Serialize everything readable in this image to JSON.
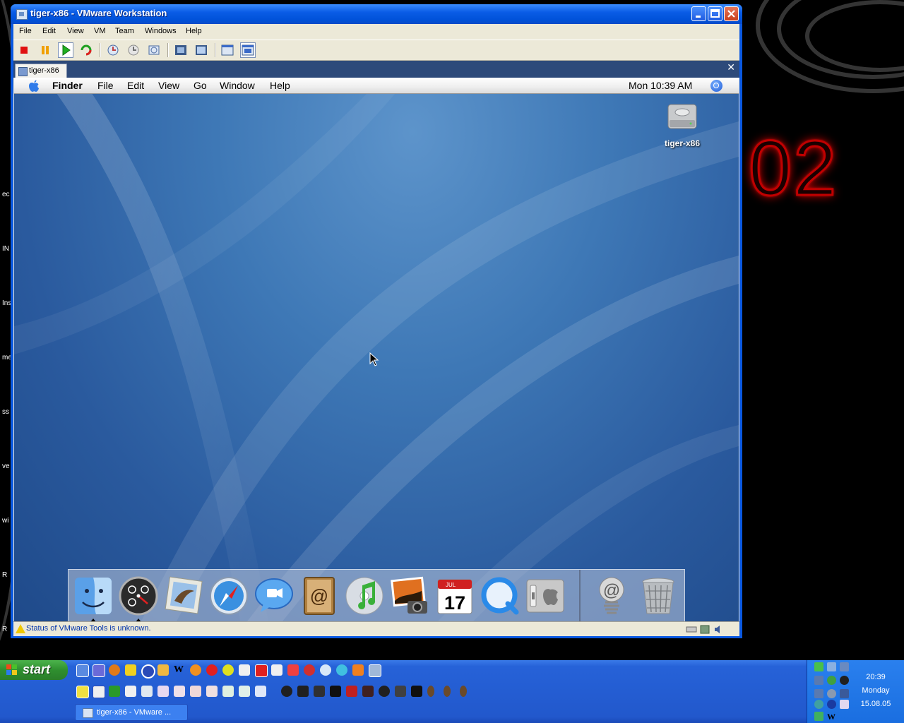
{
  "vmware": {
    "window_title": "tiger-x86 - VMware Workstation",
    "menu": [
      "File",
      "Edit",
      "View",
      "VM",
      "Team",
      "Windows",
      "Help"
    ],
    "tab_label": "tiger-x86",
    "status_text": "Status of VMware Tools is unknown."
  },
  "mac": {
    "menu": [
      "Finder",
      "File",
      "Edit",
      "View",
      "Go",
      "Window",
      "Help"
    ],
    "clock": "Mon 10:39 AM",
    "hd_label": "tiger-x86",
    "dock_items": [
      "finder-icon",
      "dashboard-icon",
      "mail-icon",
      "safari-icon",
      "ichat-icon",
      "address-book-icon",
      "itunes-icon",
      "iphoto-icon",
      "ical-icon",
      "quicktime-icon",
      "system-preferences-icon",
      "mail-downloads-icon",
      "trash-icon"
    ],
    "ical_month": "JUL",
    "ical_day": "17"
  },
  "desktop": {
    "deco_number": "02",
    "left_texts": [
      "ec",
      "IN",
      "Ins",
      "me",
      "ss",
      "ve",
      "wi",
      "R",
      "R"
    ]
  },
  "taskbar": {
    "start_label": "start",
    "task_button": "tiger-x86 - VMware ...",
    "time": "20:39",
    "day": "Monday",
    "date": "15.08.05"
  },
  "colors": {
    "xp_blue": "#0a58e0",
    "mac_blue": "#3e78b6",
    "accent_red": "#c00000"
  }
}
